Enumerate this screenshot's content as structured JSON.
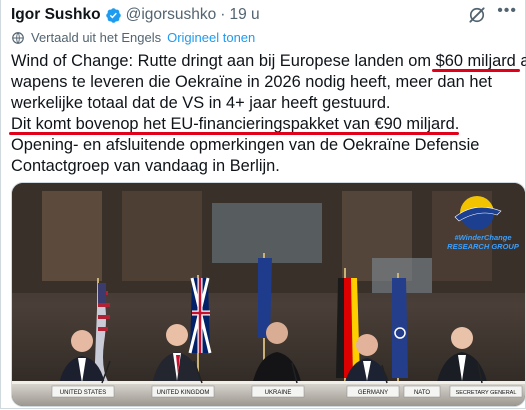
{
  "author": {
    "name": "Igor Sushko",
    "handle": "@igorsushko",
    "separator": "·",
    "time": "19 u"
  },
  "translation": {
    "label": "Vertaald uit het Engels",
    "show_original": "Origineel tonen"
  },
  "tweet": {
    "line1_pre": "Wind of Change: Rutte dringt aan bij Europese landen om ",
    "line1_highlight": "$60 miljard",
    "line1_post": " aan",
    "line2": "wapens te leveren die Oekraïne in 2026 nodig heeft, meer dan het",
    "line3": "werkelijke totaal dat de VS in 4+ jaar heeft gestuurd.",
    "line4_highlight": "Dit komt bovenop het EU-financieringspakket van €90 miljard",
    "line4_post": ".",
    "line5": "Opening- en afsluitende opmerkingen van de Oekraïne Defensie",
    "line6": "Contactgroep van vandaag in Berlijn."
  },
  "media": {
    "watermark_line1": "#WinderChange",
    "watermark_line2": "RESEARCH GROUP",
    "nameplates": [
      "UNITED STATES",
      "UNITED KINGDOM",
      "UKRAINE",
      "GERMANY",
      "NATO",
      "SECRETARY GENERAL"
    ]
  },
  "colors": {
    "verified": "#1d9bf0",
    "link": "#1d9bf0",
    "underline": "#e0001a",
    "muted": "#536471"
  }
}
